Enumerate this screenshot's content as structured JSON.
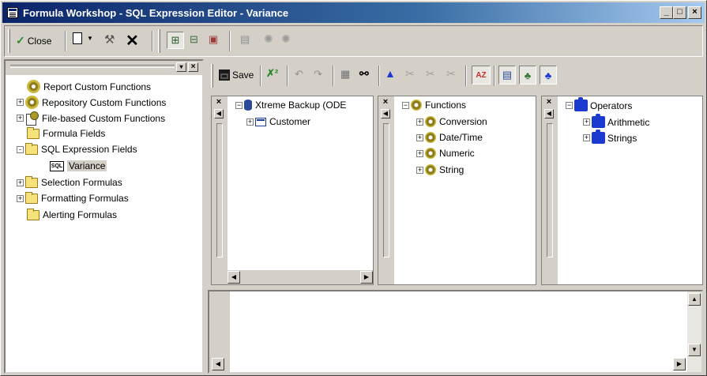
{
  "window": {
    "title": "Formula Workshop - SQL Expression Editor - Variance"
  },
  "toolbar1": {
    "close_label": "Close"
  },
  "toolbar2": {
    "save_label": "Save"
  },
  "tree": [
    {
      "label": "Report Custom Functions",
      "icon": "gear-icon",
      "expander": ""
    },
    {
      "label": "Repository Custom Functions",
      "icon": "gear-icon",
      "expander": "+"
    },
    {
      "label": "File-based Custom Functions",
      "icon": "file-gear-icon",
      "expander": "+"
    },
    {
      "label": "Formula Fields",
      "icon": "folder-icon",
      "expander": ""
    },
    {
      "label": "SQL Expression Fields",
      "icon": "folder-icon",
      "expander": "-"
    },
    {
      "label": "Variance",
      "icon": "sql-icon",
      "expander": ""
    },
    {
      "label": "Selection Formulas",
      "icon": "folder-icon",
      "expander": "+"
    },
    {
      "label": "Formatting Formulas",
      "icon": "folder-icon",
      "expander": "+"
    },
    {
      "label": "Alerting Formulas",
      "icon": "folder-icon",
      "expander": ""
    }
  ],
  "fields_pane": {
    "root": "Xtreme Backup (ODE",
    "child": "Customer"
  },
  "functions_pane": {
    "root": "Functions",
    "items": [
      "Conversion",
      "Date/Time",
      "Numeric",
      "String"
    ]
  },
  "operators_pane": {
    "root": "Operators",
    "items": [
      "Arithmetic",
      "Strings"
    ]
  }
}
